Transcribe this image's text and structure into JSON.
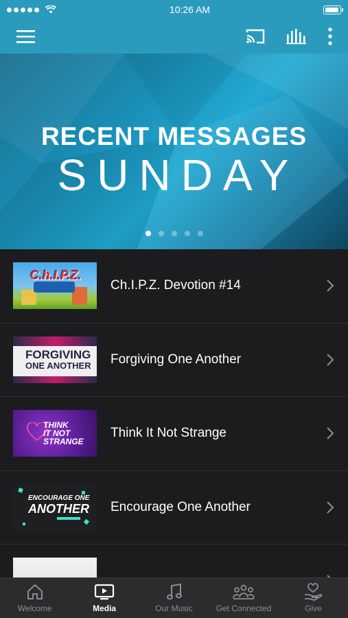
{
  "status_bar": {
    "time": "10:26 AM",
    "battery_level": 0.95
  },
  "hero": {
    "title": "RECENT MESSAGES",
    "subtitle": "SUNDAY",
    "pages": 5,
    "active_page": 0
  },
  "messages": [
    {
      "title": "Ch.I.P.Z. Devotion #14",
      "thumb_text": "C.h.I.P.Z."
    },
    {
      "title": "Forgiving One Another",
      "thumb_text_1": "FORGIVING",
      "thumb_text_2": "ONE ANOTHER"
    },
    {
      "title": "Think It Not Strange",
      "thumb_text_1": "THINK",
      "thumb_text_2": "IT NOT",
      "thumb_text_3": "STRANGE"
    },
    {
      "title": "Encourage One Another",
      "thumb_text_1": "ENCOURAGE ONE",
      "thumb_text_2": "ANOTHER"
    },
    {
      "title": ""
    }
  ],
  "tabs": [
    {
      "label": "Welcome",
      "icon": "home-icon"
    },
    {
      "label": "Media",
      "icon": "tv-play-icon",
      "active": true
    },
    {
      "label": "Our Music",
      "icon": "music-note-icon"
    },
    {
      "label": "Get Connected",
      "icon": "people-icon"
    },
    {
      "label": "Give",
      "icon": "heart-hand-icon"
    }
  ],
  "colors": {
    "accent": "#2a9bbd",
    "background": "#1c1c1e",
    "tabbar": "#2c2c2e"
  }
}
